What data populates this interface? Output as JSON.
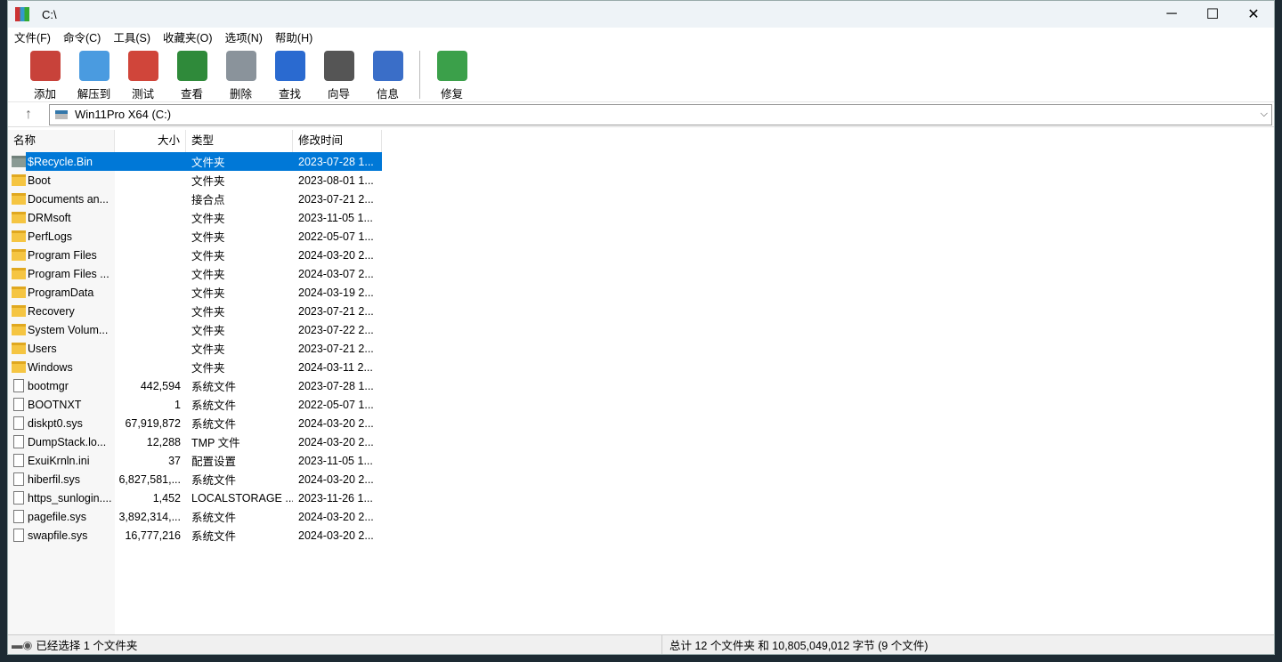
{
  "window": {
    "title": "C:\\"
  },
  "menu": [
    "文件(F)",
    "命令(C)",
    "工具(S)",
    "收藏夹(O)",
    "选项(N)",
    "帮助(H)"
  ],
  "toolbar": [
    {
      "label": "添加",
      "icon": "add-archive-icon",
      "color": "#c8423a"
    },
    {
      "label": "解压到",
      "icon": "extract-folder-icon",
      "color": "#4a9be0"
    },
    {
      "label": "测试",
      "icon": "test-clipboard-icon",
      "color": "#d0453a"
    },
    {
      "label": "查看",
      "icon": "view-book-icon",
      "color": "#2f8a3a"
    },
    {
      "label": "删除",
      "icon": "trash-icon",
      "color": "#8a939b"
    },
    {
      "label": "查找",
      "icon": "search-magnifier-icon",
      "color": "#2a6ad0"
    },
    {
      "label": "向导",
      "icon": "wizard-wand-icon",
      "color": "#555"
    },
    {
      "label": "信息",
      "icon": "info-icon",
      "color": "#3a6ec8"
    },
    {
      "label": "修复",
      "icon": "repair-icon",
      "color": "#3ba04a"
    }
  ],
  "address": {
    "path": "Win11Pro X64 (C:)"
  },
  "columns": [
    "名称",
    "大小",
    "类型",
    "修改时间"
  ],
  "files": [
    {
      "name": "$Recycle.Bin",
      "size": "",
      "type": "文件夹",
      "date": "2023-07-28 1...",
      "kind": "folder-gray",
      "selected": true
    },
    {
      "name": "Boot",
      "size": "",
      "type": "文件夹",
      "date": "2023-08-01 1...",
      "kind": "folder"
    },
    {
      "name": "Documents an...",
      "size": "",
      "type": "接合点",
      "date": "2023-07-21 2...",
      "kind": "folder"
    },
    {
      "name": "DRMsoft",
      "size": "",
      "type": "文件夹",
      "date": "2023-11-05 1...",
      "kind": "folder"
    },
    {
      "name": "PerfLogs",
      "size": "",
      "type": "文件夹",
      "date": "2022-05-07 1...",
      "kind": "folder"
    },
    {
      "name": "Program Files",
      "size": "",
      "type": "文件夹",
      "date": "2024-03-20 2...",
      "kind": "folder"
    },
    {
      "name": "Program Files ...",
      "size": "",
      "type": "文件夹",
      "date": "2024-03-07 2...",
      "kind": "folder"
    },
    {
      "name": "ProgramData",
      "size": "",
      "type": "文件夹",
      "date": "2024-03-19 2...",
      "kind": "folder"
    },
    {
      "name": "Recovery",
      "size": "",
      "type": "文件夹",
      "date": "2023-07-21 2...",
      "kind": "folder"
    },
    {
      "name": "System Volum...",
      "size": "",
      "type": "文件夹",
      "date": "2023-07-22 2...",
      "kind": "folder"
    },
    {
      "name": "Users",
      "size": "",
      "type": "文件夹",
      "date": "2023-07-21 2...",
      "kind": "folder"
    },
    {
      "name": "Windows",
      "size": "",
      "type": "文件夹",
      "date": "2024-03-11 2...",
      "kind": "folder"
    },
    {
      "name": "bootmgr",
      "size": "442,594",
      "type": "系统文件",
      "date": "2023-07-28 1...",
      "kind": "file"
    },
    {
      "name": "BOOTNXT",
      "size": "1",
      "type": "系统文件",
      "date": "2022-05-07 1...",
      "kind": "file"
    },
    {
      "name": "diskpt0.sys",
      "size": "67,919,872",
      "type": "系统文件",
      "date": "2024-03-20 2...",
      "kind": "file"
    },
    {
      "name": "DumpStack.lo...",
      "size": "12,288",
      "type": "TMP 文件",
      "date": "2024-03-20 2...",
      "kind": "file"
    },
    {
      "name": "ExuiKrnln.ini",
      "size": "37",
      "type": "配置设置",
      "date": "2023-11-05 1...",
      "kind": "file"
    },
    {
      "name": "hiberfil.sys",
      "size": "6,827,581,...",
      "type": "系统文件",
      "date": "2024-03-20 2...",
      "kind": "file"
    },
    {
      "name": "https_sunlogin....",
      "size": "1,452",
      "type": "LOCALSTORAGE ...",
      "date": "2023-11-26 1...",
      "kind": "file"
    },
    {
      "name": "pagefile.sys",
      "size": "3,892,314,...",
      "type": "系统文件",
      "date": "2024-03-20 2...",
      "kind": "file"
    },
    {
      "name": "swapfile.sys",
      "size": "16,777,216",
      "type": "系统文件",
      "date": "2024-03-20 2...",
      "kind": "file"
    }
  ],
  "status": {
    "left": "已经选择 1 个文件夹",
    "right": "总计 12 个文件夹 和 10,805,049,012 字节 (9 个文件)"
  }
}
